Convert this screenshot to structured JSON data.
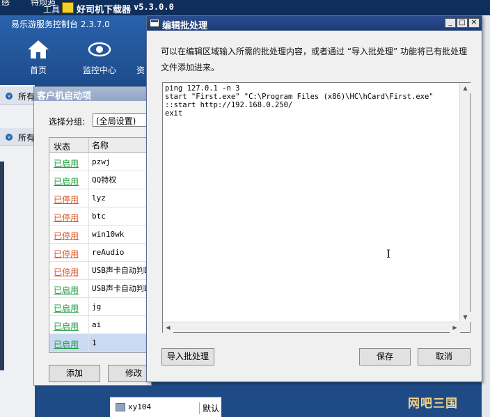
{
  "topbar": {
    "label_left": "感",
    "label_mid": "特烦遁",
    "label_tools": "工具"
  },
  "downloader": {
    "title": "好司机下载器",
    "version": "v5.3.0.0"
  },
  "app": {
    "title": "易乐游服务控制台 2.3.7.0",
    "nav": [
      {
        "label": "首页",
        "icon": "home-icon"
      },
      {
        "label": "监控中心",
        "icon": "eye-icon"
      },
      {
        "label": "资"
      }
    ],
    "sidebar": [
      "所有",
      "所有"
    ],
    "bottom_row": {
      "name": "xy104",
      "group": "默认"
    },
    "watermark": "网吧三国"
  },
  "client_dialog": {
    "title": "客户机启动项",
    "group_label": "选择分组:",
    "group_value": "(全局设置)",
    "columns": [
      "状态",
      "名称"
    ],
    "rows": [
      {
        "status": "已启用",
        "state": "on",
        "name": "pzwj"
      },
      {
        "status": "已启用",
        "state": "on",
        "name": "QQ特权"
      },
      {
        "status": "已停用",
        "state": "off",
        "name": "lyz"
      },
      {
        "status": "已停用",
        "state": "off",
        "name": "btc"
      },
      {
        "status": "已停用",
        "state": "off",
        "name": "win10wk"
      },
      {
        "status": "已停用",
        "state": "off",
        "name": "reAudio"
      },
      {
        "status": "已停用",
        "state": "off",
        "name": "USB声卡自动判断"
      },
      {
        "status": "已启用",
        "state": "on",
        "name": "USB声卡自动判断"
      },
      {
        "status": "已启用",
        "state": "on",
        "name": "jg"
      },
      {
        "status": "已启用",
        "state": "on",
        "name": "ai"
      },
      {
        "status": "已启用",
        "state": "on",
        "name": "1"
      }
    ],
    "add_label": "添加",
    "edit_label": "修改"
  },
  "edit_dialog": {
    "title": "编辑批处理",
    "instruction": "可以在编辑区域输入所需的批处理内容，或者通过 “导入批处理” 功能将已有批处理文件添加进来。",
    "script": "ping 127.0.1 -n 3\nstart \"First.exe\" \"C:\\Program Files (x86)\\HC\\hCard\\First.exe\"\n::start http://192.168.0.250/\nexit",
    "import_label": "导入批处理",
    "save_label": "保存",
    "cancel_label": "取消"
  }
}
